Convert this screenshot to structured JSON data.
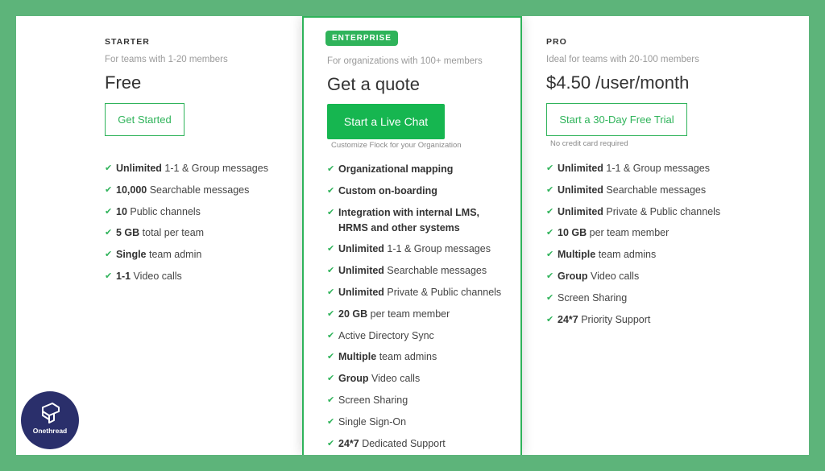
{
  "starter": {
    "tier": "STARTER",
    "subtitle": "For teams with 1-20 members",
    "price": "Free",
    "button": "Get Started",
    "features": [
      {
        "bold": "Unlimited",
        "rest": " 1-1 & Group messages"
      },
      {
        "bold": "10,000",
        "rest": " Searchable messages"
      },
      {
        "bold": "10",
        "rest": " Public channels"
      },
      {
        "bold": "5 GB",
        "rest": " total per team"
      },
      {
        "bold": "Single",
        "rest": " team admin"
      },
      {
        "bold": "1-1",
        "rest": " Video calls"
      }
    ]
  },
  "enterprise": {
    "badge": "ENTERPRISE",
    "subtitle": "For organizations with 100+ members",
    "price": "Get a quote",
    "button": "Start a Live Chat",
    "note": "Customize Flock for your Organization",
    "features": [
      {
        "bold": "Organizational mapping",
        "rest": "",
        "icon": "double-check"
      },
      {
        "bold": "Custom on-boarding",
        "rest": "",
        "icon": "double-check"
      },
      {
        "bold": "Integration with internal LMS, HRMS and other systems",
        "rest": "",
        "icon": "double-check",
        "wrap": true
      },
      {
        "bold": "Unlimited",
        "rest": " 1-1 & Group messages"
      },
      {
        "bold": "Unlimited",
        "rest": " Searchable messages"
      },
      {
        "bold": "Unlimited",
        "rest": " Private & Public channels"
      },
      {
        "bold": "20 GB",
        "rest": " per team member"
      },
      {
        "bold": "",
        "rest": "Active Directory Sync"
      },
      {
        "bold": "Multiple",
        "rest": " team admins"
      },
      {
        "bold": "Group",
        "rest": " Video calls"
      },
      {
        "bold": "",
        "rest": "Screen Sharing"
      },
      {
        "bold": "",
        "rest": "Single Sign-On"
      },
      {
        "bold": "24*7",
        "rest": " Dedicated Support"
      }
    ]
  },
  "pro": {
    "tier": "PRO",
    "subtitle": "Ideal for teams with 20-100 members",
    "price": "$4.50 /user/month",
    "button": "Start a 30-Day Free Trial",
    "note": "No credit card required",
    "features": [
      {
        "bold": "Unlimited",
        "rest": " 1-1 & Group messages"
      },
      {
        "bold": "Unlimited",
        "rest": " Searchable messages"
      },
      {
        "bold": "Unlimited",
        "rest": " Private & Public channels"
      },
      {
        "bold": "10 GB",
        "rest": " per team member"
      },
      {
        "bold": "Multiple",
        "rest": " team admins"
      },
      {
        "bold": "Group",
        "rest": " Video calls"
      },
      {
        "bold": "",
        "rest": "Screen Sharing"
      },
      {
        "bold": "24*7",
        "rest": " Priority Support"
      }
    ]
  },
  "logo": {
    "name": "Onethread"
  },
  "colors": {
    "accent": "#2fb35a",
    "background": "#5db47a",
    "logo_bg": "#2a2f6b"
  }
}
